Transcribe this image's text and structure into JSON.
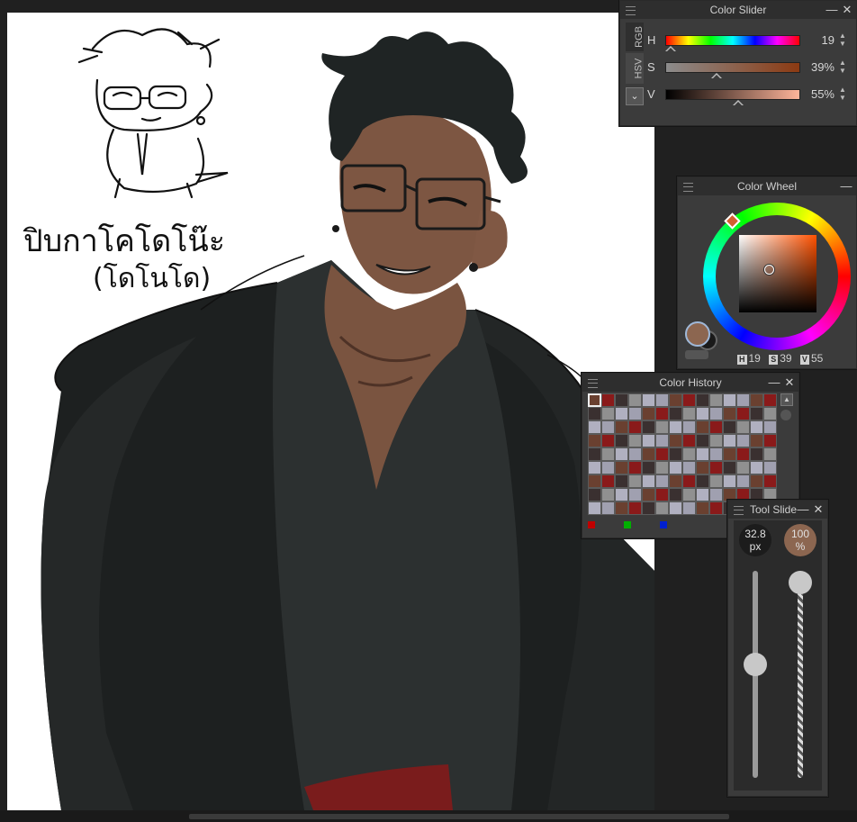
{
  "canvas": {
    "sketch_text_line1": "ปิบกาโคโดโน๊ะ",
    "sketch_text_line2": "(โดโนโด)"
  },
  "color_slider": {
    "title": "Color Slider",
    "tabs": [
      "RGB",
      "HSV"
    ],
    "rows": [
      {
        "label": "H",
        "value": "19"
      },
      {
        "label": "S",
        "value": "39%"
      },
      {
        "label": "V",
        "value": "55%"
      }
    ],
    "h_fraction": 0.053,
    "s_fraction": 0.39,
    "v_fraction": 0.55
  },
  "color_wheel": {
    "title": "Color Wheel",
    "current_color": "#8c6650",
    "readout": {
      "h_tag": "H",
      "h": "19",
      "s_tag": "S",
      "s": "39",
      "v_tag": "V",
      "v": "55"
    }
  },
  "color_history": {
    "title": "Color History",
    "dots": [
      "#c00000",
      "#00b000",
      "#0020d0"
    ]
  },
  "tool_slider": {
    "title": "Tool Slider",
    "size": "32.8 px",
    "opacity": "100 %",
    "size_fraction": 0.55,
    "opacity_fraction": 1.0
  },
  "colors": {
    "panel_bg": "#3b3b3b",
    "title_bg": "#2e2e2e",
    "workspace": "#202020",
    "accent_skin": "#8c6650"
  }
}
